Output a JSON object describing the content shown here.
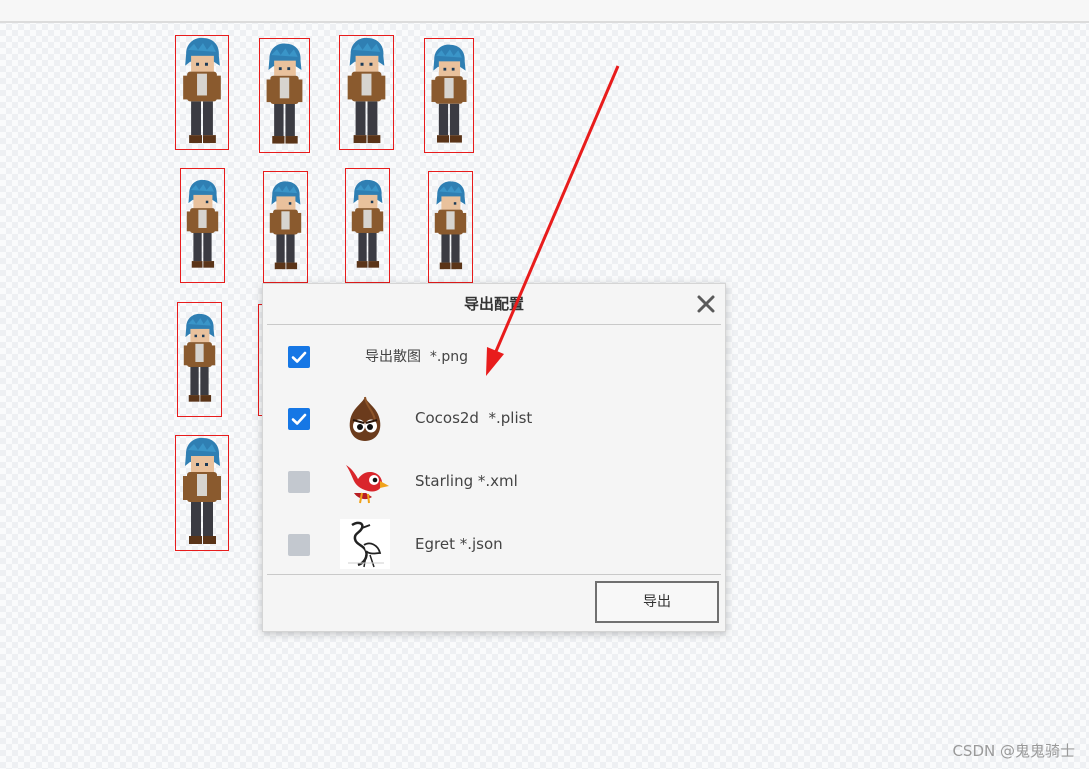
{
  "dialog": {
    "title": "导出配置",
    "close_icon": "close-icon",
    "options": [
      {
        "label": "导出散图  *.png",
        "checked": true,
        "icon": null
      },
      {
        "label": "Cocos2d  *.plist",
        "checked": true,
        "icon": "cocos2d-logo-icon"
      },
      {
        "label": "Starling *.xml",
        "checked": false,
        "icon": "starling-bird-icon"
      },
      {
        "label": "Egret *.json",
        "checked": false,
        "icon": "egret-crane-icon"
      }
    ],
    "export_label": "导出"
  },
  "colors": {
    "checkbox_checked": "#1677e5",
    "checkbox_unchecked": "#c3c8cf",
    "sprite_frame_border": "#e81c1c",
    "annotation_arrow": "#e81c1c",
    "character_hair": "#2f7fb3",
    "character_jacket": "#8a5a2e"
  },
  "annotation": {
    "type": "arrow",
    "points_to": "Cocos2d option"
  },
  "watermark": "CSDN @鬼鬼骑士"
}
